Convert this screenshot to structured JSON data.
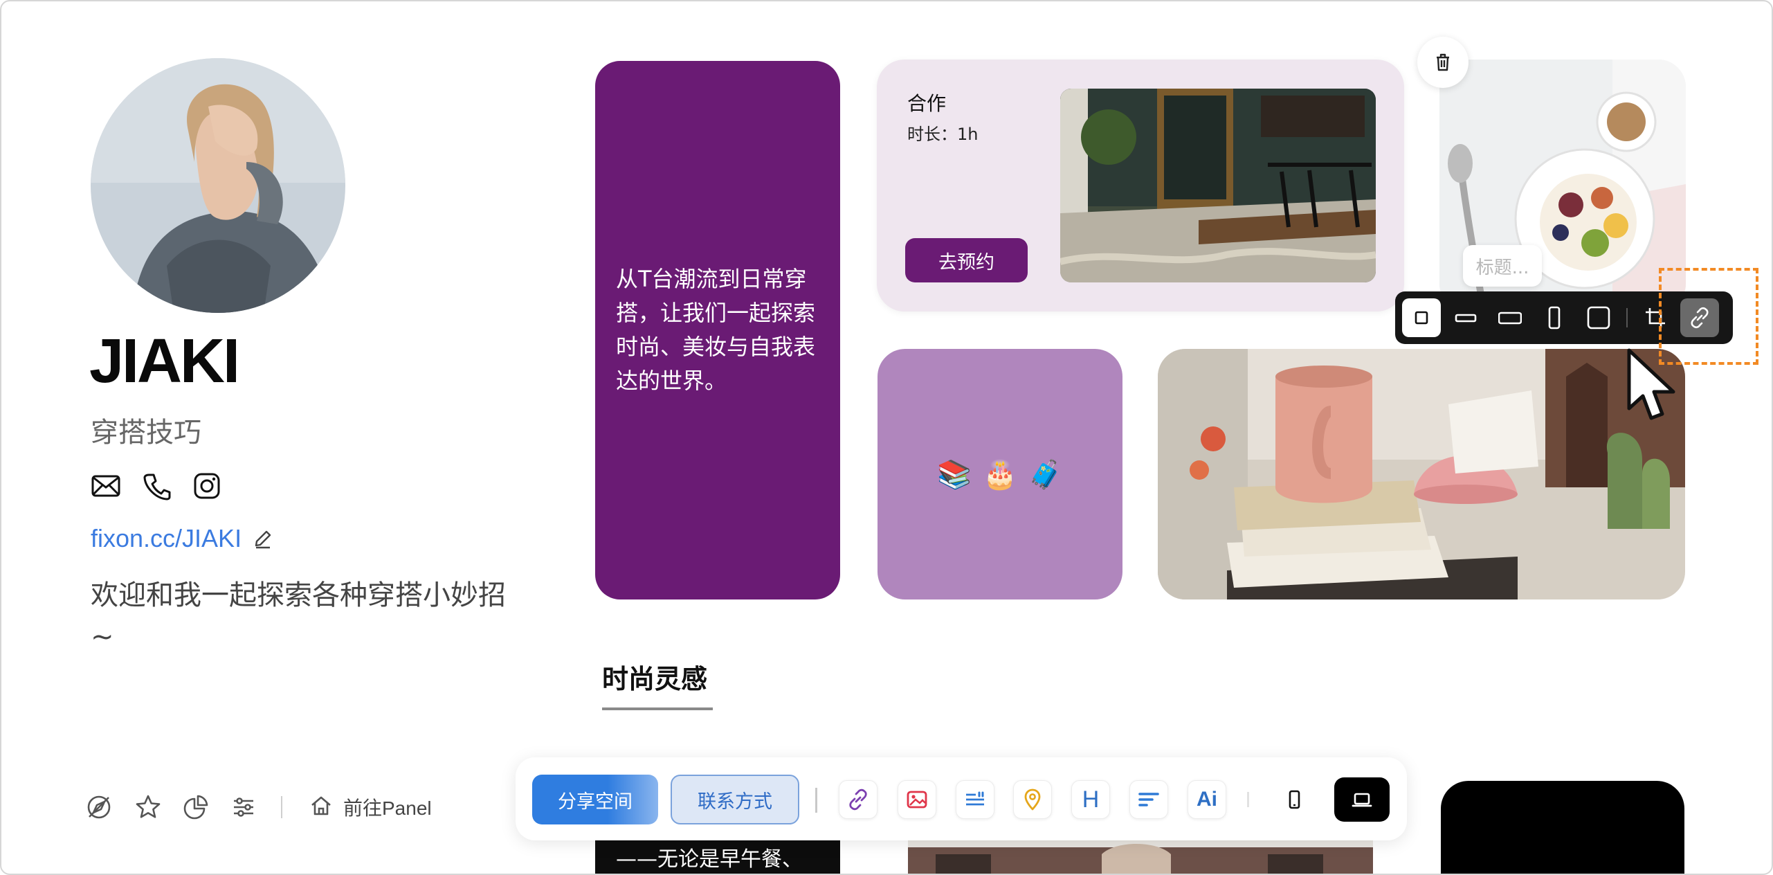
{
  "profile": {
    "name": "JIAKI",
    "tagline": "穿搭技巧",
    "link": "fixon.cc/JIAKI",
    "bio": "欢迎和我一起探索各种穿搭小妙招~",
    "contact_icons": [
      "mail-icon",
      "phone-icon",
      "instagram-icon"
    ]
  },
  "bottom_nav": {
    "icons": [
      "explore-icon",
      "star-icon",
      "pie-chart-icon",
      "sliders-icon"
    ],
    "panel_label": "前往Panel"
  },
  "cards": {
    "text_card": "从T台潮流到日常穿搭，让我们一起探索时尚、美妆与自我表达的世界。",
    "coop": {
      "title": "合作",
      "duration": "时长：1h",
      "button": "去预约"
    },
    "emoji_card": [
      "📚",
      "🎂",
      "🧳"
    ]
  },
  "editor": {
    "title_placeholder": "标题...",
    "size_options": [
      "square-small",
      "wide-short",
      "wide",
      "tall",
      "square-large"
    ],
    "active_size": "square-small",
    "tools": [
      "crop-icon",
      "link-icon"
    ]
  },
  "section": {
    "title": "时尚灵感"
  },
  "peek": {
    "text": "——无论是早午餐、"
  },
  "dock": {
    "share_label": "分享空间",
    "contact_label": "联系方式",
    "tools": [
      "link-icon",
      "image-icon",
      "quote-icon",
      "location-icon",
      "heading-icon",
      "text-icon",
      "ai-icon"
    ],
    "heading_glyph": "H",
    "ai_glyph": "Ai",
    "devices": [
      "mobile-icon",
      "desktop-icon"
    ],
    "active_device": "desktop"
  },
  "colors": {
    "brand_purple": "#6a1b74",
    "lavender": "#b086bd",
    "coop_bg": "#efe6ef",
    "link_blue": "#3b7be0",
    "accent_orange": "#f28a24",
    "primary_blue": "#2f7de0"
  }
}
